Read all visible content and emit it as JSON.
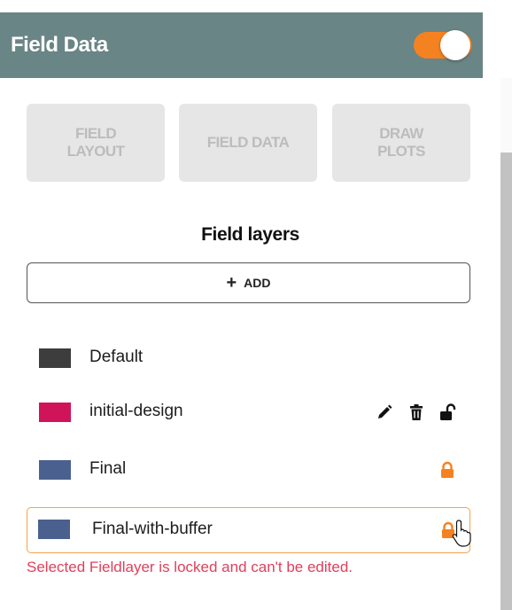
{
  "header": {
    "title": "Field Data",
    "toggle_on": true,
    "toggle_color": "#f58220",
    "bg_color": "#6a8585"
  },
  "mode_buttons": [
    {
      "label": "FIELD\nLAYOUT"
    },
    {
      "label": "FIELD DATA"
    },
    {
      "label": "DRAW\nPLOTS"
    }
  ],
  "layers_section": {
    "title": "Field layers",
    "add_button": {
      "icon": "plus-icon",
      "label": "ADD"
    },
    "items": [
      {
        "name": "Default",
        "color": "#3d3d3d",
        "icons": []
      },
      {
        "name": "initial-design",
        "color": "#d0145a",
        "icons": [
          "pencil-icon",
          "trash-icon",
          "unlocked-icon"
        ]
      },
      {
        "name": "Final",
        "color": "#4a6190",
        "icons": [
          "lock-icon"
        ]
      },
      {
        "name": "Final-with-buffer",
        "color": "#4a6190",
        "icons": [
          "lock-icon"
        ],
        "selected": true
      }
    ]
  },
  "error_message": "Selected Fieldlayer is locked and can't be edited.",
  "colors": {
    "accent": "#f58220",
    "lock": "#f58220",
    "error": "#e0405a"
  }
}
